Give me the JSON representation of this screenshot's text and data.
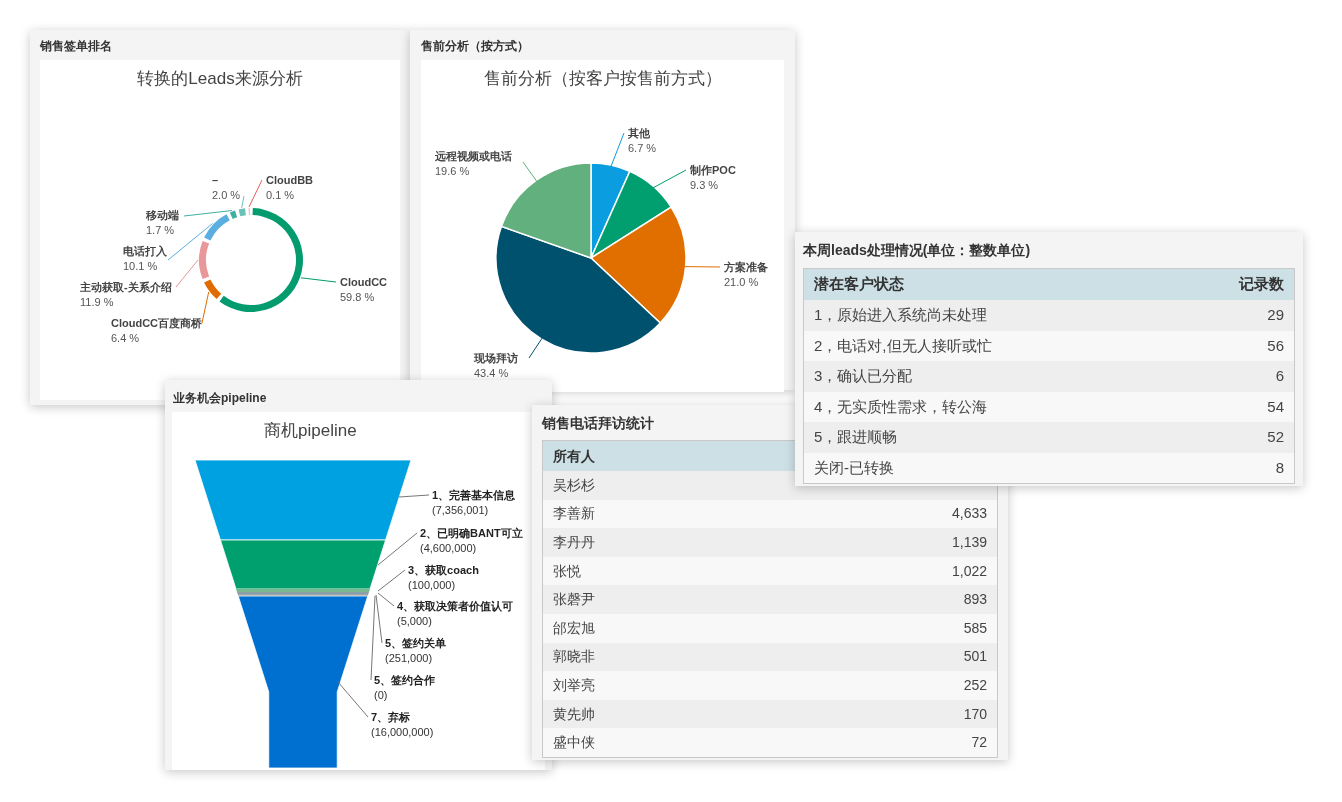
{
  "donut_card": {
    "title": "销售签单排名",
    "chart_data": {
      "type": "donut",
      "title": "转换的Leads来源分析",
      "categories": [
        "CloudCC",
        "CloudCC百度商桥",
        "主动获取-关系介绍",
        "电话打入",
        "移动端",
        "–",
        "CloudBB"
      ],
      "values": [
        59.8,
        6.4,
        11.9,
        10.1,
        1.7,
        2.0,
        0.1
      ],
      "value_labels": [
        "59.8 %",
        "6.4 %",
        "11.9 %",
        "10.1 %",
        "1.7 %",
        "2.0 %",
        "0.1 %"
      ],
      "colors": [
        "#049b6e",
        "#e06c00",
        "#e89898",
        "#5aaee0",
        "#3fb0a0",
        "#6cc0b8",
        "#e86060"
      ],
      "data_labels": true
    }
  },
  "pie_card": {
    "title": "售前分析（按方式）",
    "chart_data": {
      "type": "pie",
      "title": "售前分析（按客户按售前方式）",
      "categories": [
        "其他",
        "制作POC",
        "方案准备",
        "现场拜访",
        "远程视频或电话"
      ],
      "values": [
        6.7,
        9.3,
        21.0,
        43.4,
        19.6
      ],
      "value_labels": [
        "6.7 %",
        "9.3 %",
        "21.0 %",
        "43.4 %",
        "19.6 %"
      ],
      "colors": [
        "#0a9de0",
        "#019e70",
        "#e06f00",
        "#00516e",
        "#61b07e"
      ],
      "data_labels": true
    }
  },
  "leads_card": {
    "title": "本周leads处理情况(单位：整数单位)",
    "columns": [
      "潜在客户状态",
      "记录数"
    ],
    "rows": [
      {
        "status": "1，原始进入系统尚未处理",
        "count": "29"
      },
      {
        "status": "2，电话对,但无人接听或忙",
        "count": "56"
      },
      {
        "status": "3，确认已分配",
        "count": "6"
      },
      {
        "status": "4，无实质性需求，转公海",
        "count": "54"
      },
      {
        "status": "5，跟进顺畅",
        "count": "52"
      },
      {
        "status": "关闭-已转换",
        "count": "8"
      }
    ]
  },
  "pipeline_card": {
    "title": "业务机会pipeline",
    "chart_title": "商机pipeline",
    "stages": [
      {
        "label": "1、完善基本信息",
        "value": "(7,356,001)",
        "color": "#00a1e0"
      },
      {
        "label": "2、已明确BANT可立",
        "value": "(4,600,000)",
        "color": "#00a06e"
      },
      {
        "label": "3、获取coach",
        "value": "(100,000)",
        "color": "#7ab890"
      },
      {
        "label": "4、获取决策者价值认可",
        "value": "(5,000)",
        "color": "#8aa0a8"
      },
      {
        "label": "5、签约关单",
        "value": "(251,000)",
        "color": "#a0a4a8"
      },
      {
        "label": "5、签约合作",
        "value": "(0)"
      },
      {
        "label": "7、弃标",
        "value": "(16,000,000)",
        "color": "#0070d0"
      }
    ]
  },
  "calls_card": {
    "title": "销售电话拜访统计",
    "columns": [
      "所有人"
    ],
    "rows": [
      {
        "owner": "吴杉杉"
      },
      {
        "owner": "李善新",
        "count": "4,633"
      },
      {
        "owner": "李丹丹",
        "count": "1,139"
      },
      {
        "owner": "张悦",
        "count": "1,022"
      },
      {
        "owner": "张磬尹",
        "count": "893"
      },
      {
        "owner": "邰宏旭",
        "count": "585"
      },
      {
        "owner": "郭晓非",
        "count": "501"
      },
      {
        "owner": "刘举亮",
        "count": "252"
      },
      {
        "owner": "黄先帅",
        "count": "170"
      },
      {
        "owner": "盛中侠",
        "count": "72"
      }
    ]
  }
}
